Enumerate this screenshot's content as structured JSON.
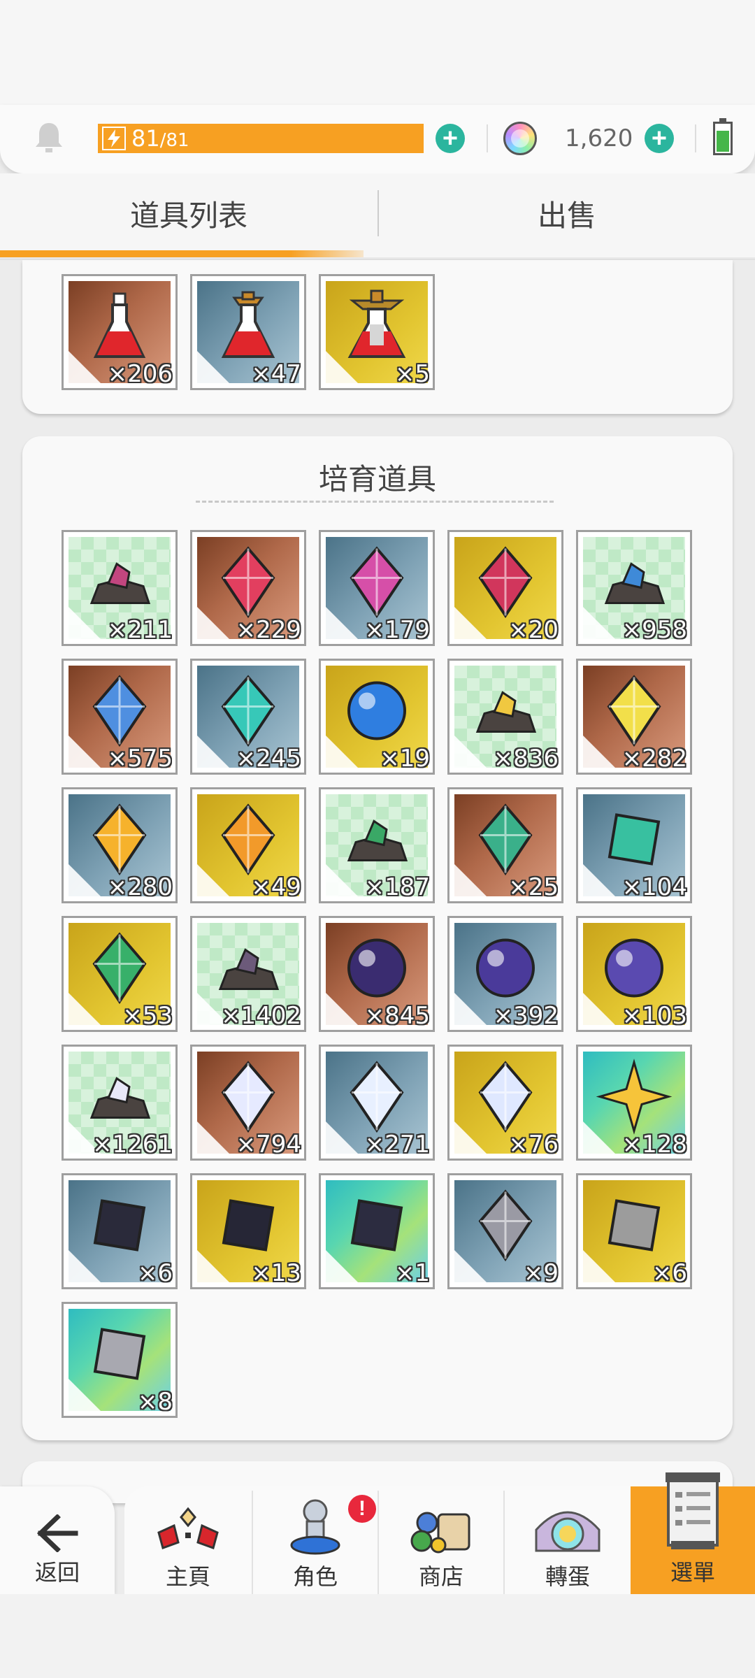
{
  "status": {
    "energy_current": "81",
    "energy_max": "/81",
    "energy_fraction": 1.0,
    "gems": "1,620"
  },
  "tabs": {
    "items_label": "道具列表",
    "sell_label": "出售"
  },
  "potions": [
    {
      "count": "×206",
      "bg": "brown",
      "icon": "red-potion-icon"
    },
    {
      "count": "×47",
      "bg": "blue",
      "icon": "red-potion-icon"
    },
    {
      "count": "×5",
      "bg": "gold",
      "icon": "red-potion-icon"
    }
  ],
  "training": {
    "title": "培育道具",
    "items": [
      {
        "count": "×211",
        "bg": "green",
        "icon": "pink-ore-icon"
      },
      {
        "count": "×229",
        "bg": "brown",
        "icon": "ruby-icon"
      },
      {
        "count": "×179",
        "bg": "blue",
        "icon": "pink-crystal-icon"
      },
      {
        "count": "×20",
        "bg": "gold",
        "icon": "pink-octahedron-icon"
      },
      {
        "count": "×958",
        "bg": "green",
        "icon": "blue-ore-icon"
      },
      {
        "count": "×575",
        "bg": "brown",
        "icon": "blue-shard-icon"
      },
      {
        "count": "×245",
        "bg": "blue",
        "icon": "aqua-gem-icon"
      },
      {
        "count": "×19",
        "bg": "gold",
        "icon": "blue-orb-icon"
      },
      {
        "count": "×836",
        "bg": "green",
        "icon": "gold-ore-icon"
      },
      {
        "count": "×282",
        "bg": "brown",
        "icon": "yellow-gem-icon"
      },
      {
        "count": "×280",
        "bg": "blue",
        "icon": "amber-gem-icon"
      },
      {
        "count": "×49",
        "bg": "gold",
        "icon": "winged-amber-icon"
      },
      {
        "count": "×187",
        "bg": "green",
        "icon": "green-ore-icon"
      },
      {
        "count": "×25",
        "bg": "brown",
        "icon": "green-crystals-icon"
      },
      {
        "count": "×104",
        "bg": "blue",
        "icon": "emerald-icon"
      },
      {
        "count": "×53",
        "bg": "gold",
        "icon": "emerald-crest-icon"
      },
      {
        "count": "×1402",
        "bg": "green",
        "icon": "dark-ore-icon"
      },
      {
        "count": "×845",
        "bg": "brown",
        "icon": "dark-orb-icon"
      },
      {
        "count": "×392",
        "bg": "blue",
        "icon": "purple-orb-icon"
      },
      {
        "count": "×103",
        "bg": "gold",
        "icon": "winged-purple-orb-icon"
      },
      {
        "count": "×1261",
        "bg": "green",
        "icon": "white-ore-icon"
      },
      {
        "count": "×794",
        "bg": "brown",
        "icon": "white-crystal-icon"
      },
      {
        "count": "×271",
        "bg": "blue",
        "icon": "diamond-icon"
      },
      {
        "count": "×76",
        "bg": "gold",
        "icon": "winged-diamond-icon"
      },
      {
        "count": "×128",
        "bg": "rainbow",
        "icon": "gold-star-icon"
      },
      {
        "count": "×6",
        "bg": "blue",
        "icon": "rune-stone-icon"
      },
      {
        "count": "×13",
        "bg": "gold",
        "icon": "rune-slab-icon"
      },
      {
        "count": "×1",
        "bg": "rainbow",
        "icon": "rune-monolith-icon"
      },
      {
        "count": "×9",
        "bg": "blue",
        "icon": "grey-stone-icon"
      },
      {
        "count": "×6",
        "bg": "gold",
        "icon": "grey-rock-icon"
      },
      {
        "count": "×8",
        "bg": "rainbow",
        "icon": "grey-cube-icon"
      }
    ]
  },
  "nav": {
    "back": "返回",
    "home": "主頁",
    "character": "角色",
    "character_badge": "!",
    "shop": "商店",
    "gacha": "轉蛋",
    "menu": "選單"
  }
}
